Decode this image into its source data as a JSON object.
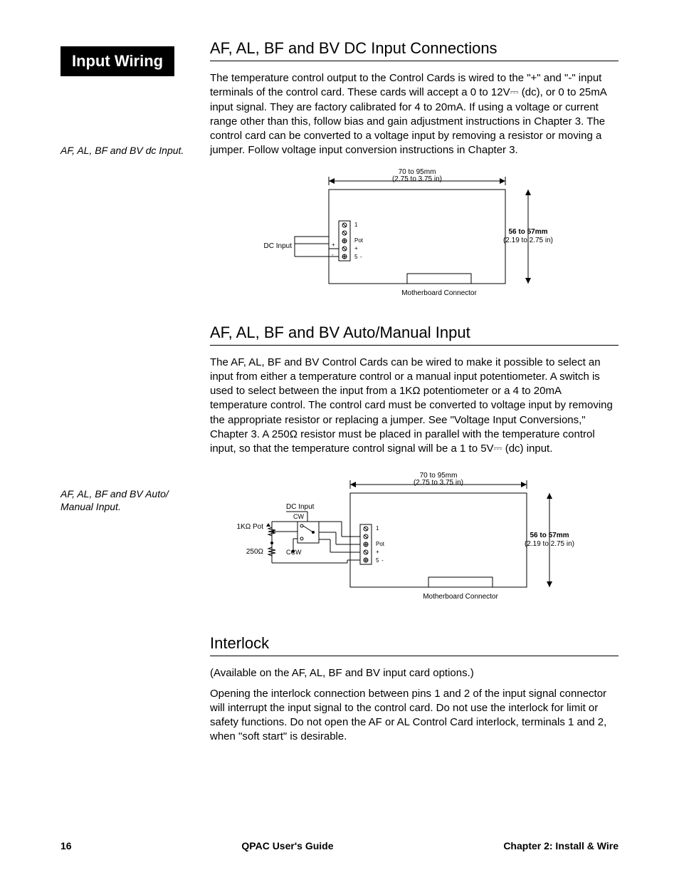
{
  "sidebar": {
    "badge": "Input Wiring",
    "note1": "AF, AL, BF and BV dc Input.",
    "note2": "AF, AL, BF and BV Auto/ Manual Input."
  },
  "section1": {
    "title": "AF, AL, BF and BV DC Input Connections",
    "body": "The temperature control output to the Control Cards is wired to the \"+\" and \"-\" input terminals of the control card. These cards will accept a 0 to 12V⎓ (dc), or 0 to 25mA input signal. They are factory calibrated for 4 to 20mA. If using a voltage or current range other than this, follow bias and gain adjustment instructions in Chapter 3. The control card can be converted to a voltage input by removing a resistor or moving a jumper. Follow voltage input conversion instructions in Chapter 3."
  },
  "section2": {
    "title": "AF, AL, BF and BV Auto/Manual Input",
    "body": "The AF, AL, BF and BV Control Cards can be wired to make it possible to select an input from either a temperature control or a manual input potentiometer. A switch is used to select between the input from a 1KΩ potentiometer or a 4 to 20mA temperature control. The control card must be converted to voltage input by removing the appropriate resistor or replacing a jumper. See \"Voltage Input Conversions,\" Chapter 3. A 250Ω resistor must be placed in parallel with the temperature control input, so that the temperature control signal will be a 1 to 5V⎓ (dc) input."
  },
  "section3": {
    "title": "Interlock",
    "p1": "(Available on the AF, AL, BF and BV input card options.)",
    "p2": "Opening the interlock connection between pins 1 and 2 of the input signal connector will interrupt the input signal to the control card. Do not use the interlock for limit or safety functions. Do not open the AF or AL Control Card interlock, terminals 1 and 2, when \"soft start\" is desirable."
  },
  "diagram1": {
    "dim_w1": "70 to 95mm",
    "dim_w2": "(2.75 to 3.75 in)",
    "dim_h1": "56 to 57mm",
    "dim_h2": "(2.19 to 2.75 in)",
    "dc_input": "DC Input",
    "pin1": "1",
    "pot": "Pot",
    "plus": "+",
    "pin5": "5",
    "minus": "-",
    "mb": "Motherboard Connector",
    "plus_sign": "+",
    "minus_sign": "-"
  },
  "diagram2": {
    "dim_w1": "70 to 95mm",
    "dim_w2": "(2.75 to 3.75 in)",
    "dim_h1": "56 to 57mm",
    "dim_h2": "(2.19 to 2.75 in)",
    "dc_input": "DC Input",
    "cw": "CW",
    "ccw": "CCW",
    "pot1k": "1KΩ Pot",
    "r250": "250Ω",
    "pin1": "1",
    "pot": "Pot",
    "plus": "+",
    "pin5": "5",
    "minus": "-",
    "mb": "Motherboard Connector"
  },
  "footer": {
    "page": "16",
    "center": "QPAC User's Guide",
    "right": "Chapter 2: Install & Wire"
  }
}
